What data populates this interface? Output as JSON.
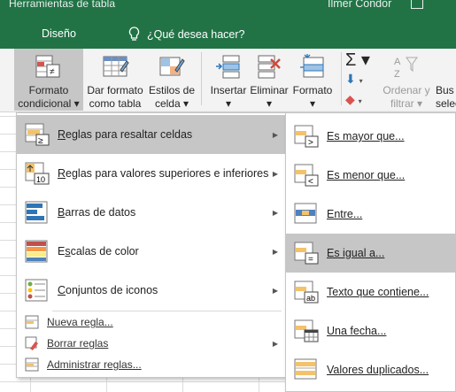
{
  "title_bar": {
    "context": "Herramientas de tabla",
    "user": "Ilmer Condor"
  },
  "tabs": {
    "active": "Diseño",
    "tell_me": "¿Qué desea hacer?"
  },
  "ribbon": {
    "formato_condicional": [
      "Formato",
      "condicional ▾"
    ],
    "dar_formato_tabla": [
      "Dar formato",
      "como tabla ▾"
    ],
    "estilos_celda": [
      "Estilos de",
      "celda ▾"
    ],
    "insertar": [
      "Insertar",
      "▾"
    ],
    "eliminar": [
      "Eliminar",
      "▾"
    ],
    "formato": [
      "Formato",
      "▾"
    ],
    "ordenar": [
      "Ordenar y",
      "filtrar ▾"
    ],
    "buscar": [
      "Bus",
      "selec"
    ],
    "autosum": "Σ ▾"
  },
  "menu_main": {
    "items": [
      {
        "label_pre": "",
        "label_ul": "R",
        "label_post": "eglas para resaltar celdas"
      },
      {
        "label_pre": "",
        "label_ul": "R",
        "label_post": "eglas para valores superiores e inferiores"
      },
      {
        "label_pre": "",
        "label_ul": "B",
        "label_post": "arras de datos"
      },
      {
        "label_pre": "E",
        "label_ul": "s",
        "label_post": "calas de color"
      },
      {
        "label_pre": "",
        "label_ul": "C",
        "label_post": "onjuntos de iconos"
      }
    ],
    "small_items": [
      "Nueva regla...",
      "Borrar reglas",
      "Administrar reglas..."
    ]
  },
  "submenu": {
    "items": [
      {
        "label": "Es mayor que..."
      },
      {
        "label": "Es menor que..."
      },
      {
        "label": "Entre..."
      },
      {
        "label": "Es igual a..."
      },
      {
        "label": "Texto que contiene..."
      },
      {
        "label": "Una fecha..."
      },
      {
        "label": "Valores duplicados..."
      }
    ]
  },
  "colors": {
    "excel_green": "#217346",
    "highlight": "#c6c6c6",
    "ribbon_bg": "#f3f3f3"
  }
}
